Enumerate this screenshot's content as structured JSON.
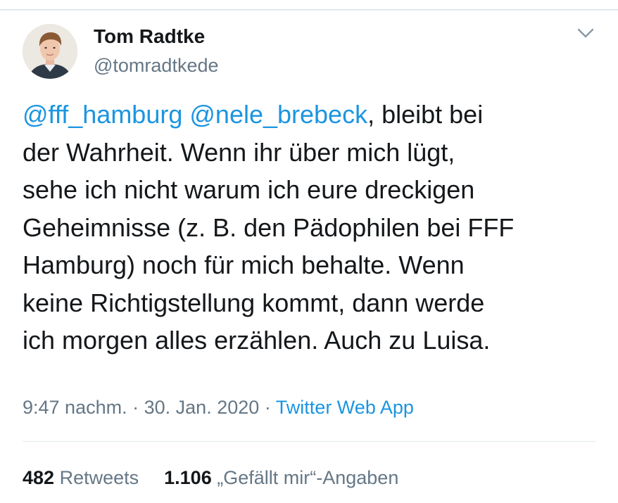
{
  "author": {
    "name": "Tom Radtke",
    "handle": "@tomradtkede"
  },
  "tweet": {
    "lines": [
      {
        "mentions": [
          "@fff_hamburg",
          "@nele_brebeck"
        ],
        "rest": ", bleibt bei"
      },
      "der Wahrheit. Wenn ihr über mich lügt,",
      "sehe ich nicht warum ich eure dreckigen",
      "Geheimnisse (z. B. den Pädophilen bei FFF",
      "Hamburg) noch für mich behalte. Wenn",
      "keine Richtigstellung kommt, dann werde",
      "ich morgen alles erzählen. Auch zu Luisa."
    ]
  },
  "meta": {
    "time": "9:47 nachm.",
    "separator": "·",
    "date": "30. Jan. 2020",
    "source": "Twitter Web App"
  },
  "stats": {
    "retweets_count": "482",
    "retweets_label": "Retweets",
    "likes_count": "1.106",
    "likes_label": "„Gefällt mir“-Angaben"
  },
  "icons": {
    "caret": "chevron-down-icon",
    "avatar": "profile-photo"
  },
  "colors": {
    "link": "#1b95e0",
    "secondary_text": "#657786",
    "primary_text": "#14171a",
    "divider": "#e1e8ed"
  }
}
